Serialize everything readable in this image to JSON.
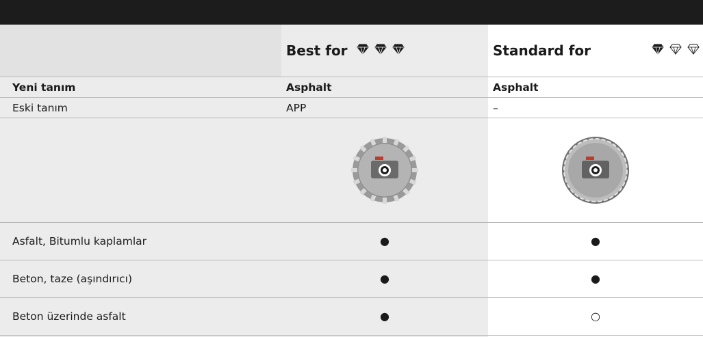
{
  "header": {
    "best_title": "Best for",
    "best_gems": "💎💎💎",
    "standard_title": "Standard for",
    "standard_gems": "💎◇◇"
  },
  "rows": {
    "new_name": {
      "label": "Yeni tanım",
      "best": "Asphalt",
      "standard": "Asphalt"
    },
    "old_name": {
      "label": "Eski tanım",
      "best": "APP",
      "standard": "–"
    }
  },
  "applications": [
    {
      "label": "Asfalt, Bitumlu kaplamlar",
      "best": "●",
      "standard": "●"
    },
    {
      "label": "Beton, taze (aşındırıcı)",
      "best": "●",
      "standard": "●"
    },
    {
      "label": "Beton üzerinde asfalt",
      "best": "●",
      "standard": "○"
    }
  ],
  "colors": {
    "topbar": "#1c1c1c",
    "shaded_column": "#ececec",
    "rule": "#b8b8b8"
  }
}
